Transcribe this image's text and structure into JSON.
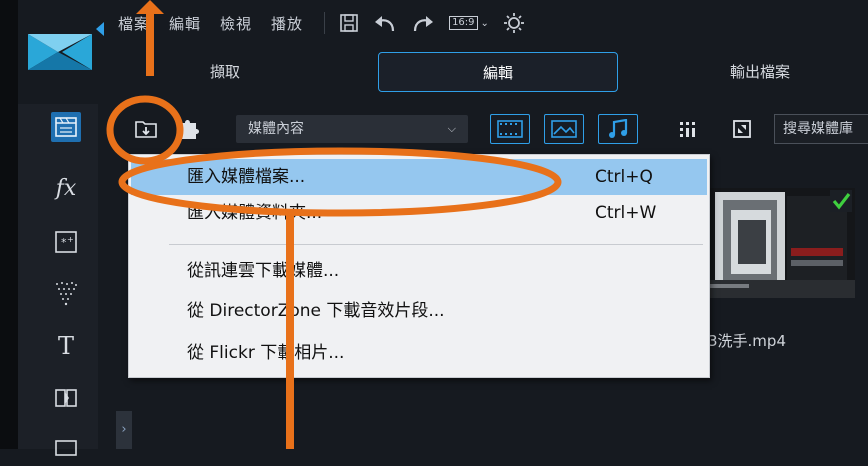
{
  "menu": [
    "檔案",
    "編輯",
    "檢視",
    "播放"
  ],
  "toolbar": {
    "aspect_ratio": "16:9",
    "icons": [
      "save-icon",
      "undo-icon",
      "redo-icon",
      "aspect-ratio-icon",
      "settings-icon"
    ]
  },
  "mode_tabs": {
    "capture": "擷取",
    "edit": "編輯",
    "produce": "輸出檔案"
  },
  "rooms": [
    "media-room-icon",
    "fx-icon",
    "pip-icon",
    "particle-icon",
    "title-icon",
    "transition-icon"
  ],
  "library": {
    "dropdown_value": "媒體內容",
    "search_placeholder": "搜尋媒體庫"
  },
  "context_menu": {
    "items": [
      {
        "label": "匯入媒體檔案...",
        "shortcut": "Ctrl+Q"
      },
      {
        "label": "匯入媒體資料夾...",
        "shortcut": "Ctrl+W"
      },
      {
        "label": "從訊連雲下載媒體...",
        "shortcut": ""
      },
      {
        "label": "從 DirectorZone 下載音效片段...",
        "shortcut": ""
      },
      {
        "label": "從 Flickr 下載相片...",
        "shortcut": ""
      }
    ]
  },
  "media_clip": {
    "caption": "3洗手.mp4"
  },
  "colors": {
    "accent": "#2f9fe8",
    "annotation": "#e8711a",
    "menu_highlight": "#95c7ef",
    "background": "#161a20"
  }
}
